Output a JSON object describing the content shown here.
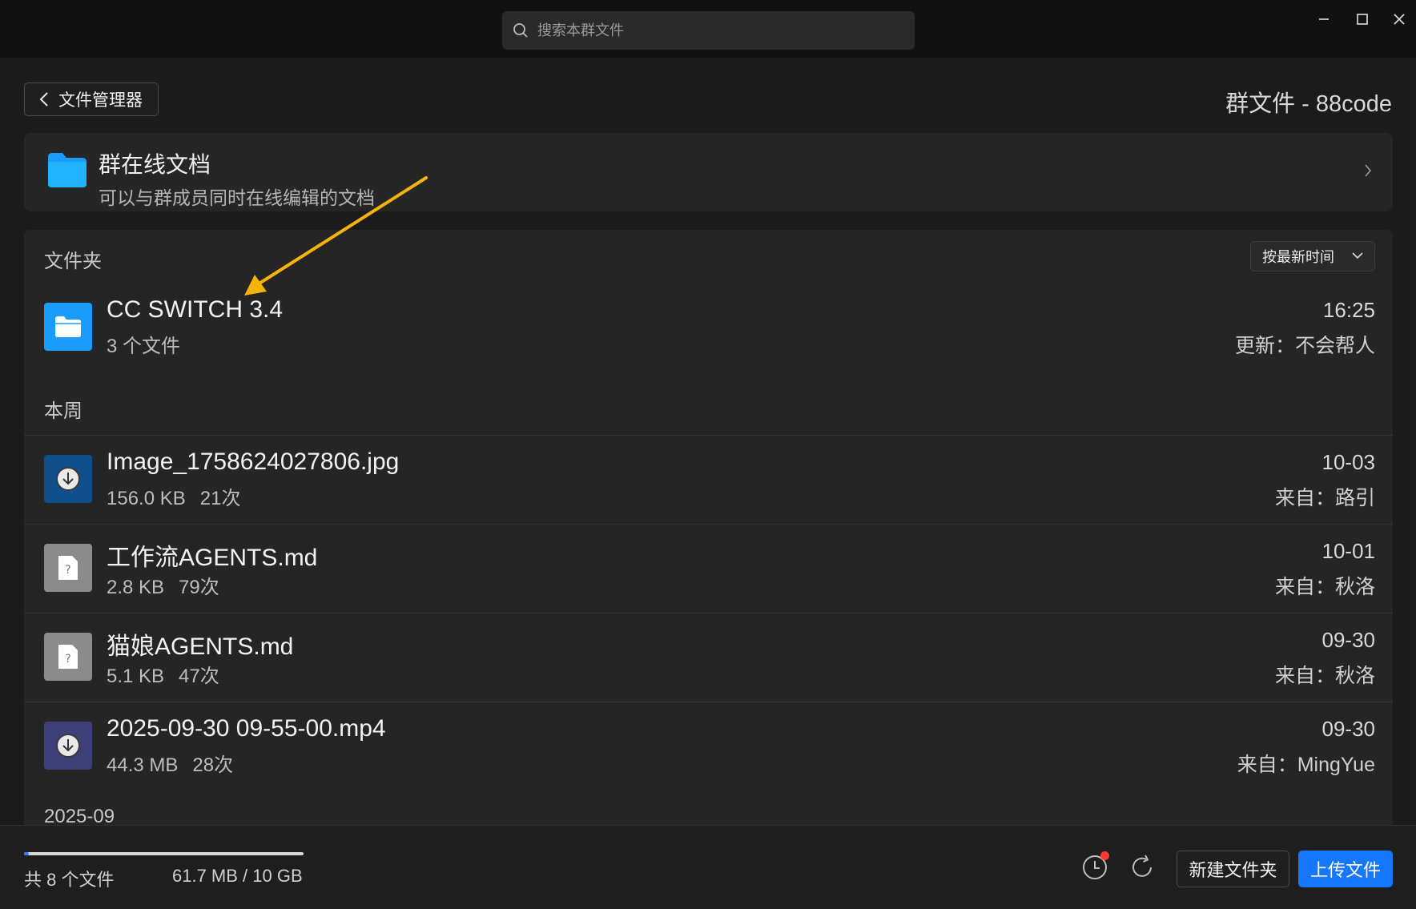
{
  "search": {
    "placeholder": "搜索本群文件"
  },
  "header": {
    "back_label": "文件管理器",
    "group_title": "群文件 - 88code"
  },
  "online_docs": {
    "title": "群在线文档",
    "subtitle": "可以与群成员同时在线编辑的文档"
  },
  "folders": {
    "section_label": "文件夹",
    "sort_label": "按最新时间",
    "items": [
      {
        "name": "CC SWITCH 3.4",
        "meta": "3 个文件",
        "date": "16:25",
        "updated_by": "更新：不会帮人"
      }
    ]
  },
  "files": {
    "section_this_week": "本周",
    "section_next": "2025-09",
    "items": [
      {
        "name": "Image_1758624027806.jpg",
        "size": "156.0 KB",
        "downloads": "21次",
        "date": "10-03",
        "from": "来自：路引",
        "icon": "download-icon",
        "color": "#0f4f8c"
      },
      {
        "name": "工作流AGENTS.md",
        "size": "2.8 KB",
        "downloads": "79次",
        "date": "10-01",
        "from": "来自：秋洛",
        "icon": "unknown-file-icon",
        "color": "#8b8b8b"
      },
      {
        "name": "猫娘AGENTS.md",
        "size": "5.1 KB",
        "downloads": "47次",
        "date": "09-30",
        "from": "来自：秋洛",
        "icon": "unknown-file-icon",
        "color": "#8b8b8b"
      },
      {
        "name": "2025-09-30 09-55-00.mp4",
        "size": "44.3 MB",
        "downloads": "28次",
        "date": "09-30",
        "from": "来自：MingYue",
        "icon": "download-icon",
        "color": "#3d3f78"
      }
    ]
  },
  "footer": {
    "count": "共 8 个文件",
    "usage": "61.7 MB / 10 GB",
    "usage_fraction": 0.006,
    "new_folder_label": "新建文件夹",
    "upload_label": "上传文件"
  },
  "colors": {
    "accent": "#1677ff",
    "annotation_arrow": "#f5b30a",
    "folder": "#1a9bff"
  }
}
